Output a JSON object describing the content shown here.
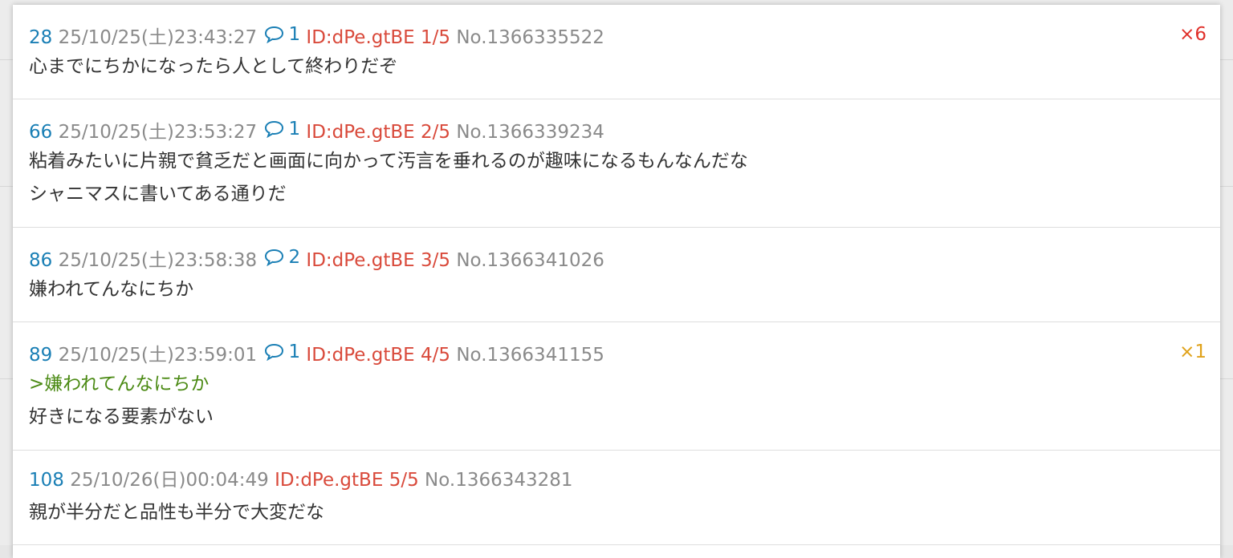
{
  "colors": {
    "number": "#1a7fb5",
    "date": "#8a8a8a",
    "id": "#d94a3b",
    "quote": "#4b8a14",
    "badge_red": "#e0302a",
    "badge_gold": "#e0a21a"
  },
  "posts": [
    {
      "number": "28",
      "date": "25/10/25(土)23:43:27",
      "reply_count": "1",
      "id": "ID:dPe.gtBE",
      "id_count": "1/5",
      "no": "No.1366335522",
      "badge": "×6",
      "lines": [
        "心までにちかになったら人として終わりだぞ"
      ]
    },
    {
      "number": "66",
      "date": "25/10/25(土)23:53:27",
      "reply_count": "1",
      "id": "ID:dPe.gtBE",
      "id_count": "2/5",
      "no": "No.1366339234",
      "lines": [
        "粘着みたいに片親で貧乏だと画面に向かって汚言を垂れるのが趣味になるもんなんだな",
        "シャニマスに書いてある通りだ"
      ]
    },
    {
      "number": "86",
      "date": "25/10/25(土)23:58:38",
      "reply_count": "2",
      "id": "ID:dPe.gtBE",
      "id_count": "3/5",
      "no": "No.1366341026",
      "lines": [
        "嫌われてんなにちか"
      ]
    },
    {
      "number": "89",
      "date": "25/10/25(土)23:59:01",
      "reply_count": "1",
      "id": "ID:dPe.gtBE",
      "id_count": "4/5",
      "no": "No.1366341155",
      "badge": "×1",
      "quote": ">嫌われてんなにちか",
      "lines": [
        "好きになる要素がない"
      ]
    },
    {
      "number": "108",
      "date": "25/10/26(日)00:04:49",
      "id": "ID:dPe.gtBE",
      "id_count": "5/5",
      "no": "No.1366343281",
      "lines": [
        "親が半分だと品性も半分で大変だな"
      ]
    }
  ]
}
